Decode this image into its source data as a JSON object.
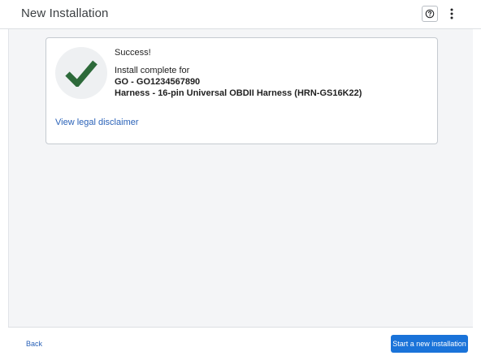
{
  "header": {
    "title": "New Installation",
    "help_icon": "question-circle-icon",
    "more_icon": "more-vertical-icon"
  },
  "card": {
    "status_icon": "checkmark-icon",
    "success_title": "Success!",
    "install_line": "Install complete for",
    "device_line": "GO - GO1234567890",
    "harness_line": "Harness - 16-pin Universal OBDII Harness (HRN-GS16K22)",
    "disclaimer_link": "View legal disclaimer"
  },
  "footer": {
    "back_label": "Back",
    "primary_label": "Start a new installation"
  },
  "colors": {
    "check_green": "#2d6a3a",
    "link_blue": "#2a62b8",
    "primary_blue": "#1a73d9"
  }
}
